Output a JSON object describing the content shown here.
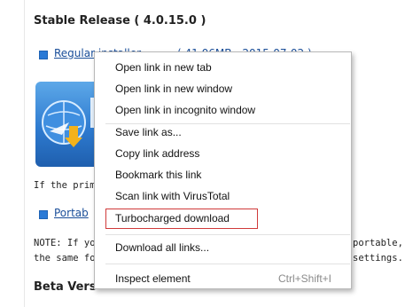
{
  "page": {
    "stable_heading": "Stable Release ( 4.0.15.0 )",
    "regular_link_label": "Regular installer",
    "regular_link_meta": "( 41.06MB - 2015-07-02 )",
    "primary_note_start": "If the prima",
    "portable_link_label": "Portab",
    "note_line1_start": "NOTE: If yo",
    "note_line1_end": "portable, c",
    "note_line2_start": "the same fo",
    "note_line2_end": "settings.",
    "beta_heading": "Beta Vers"
  },
  "context_menu": {
    "items": [
      {
        "label": "Open link in new tab"
      },
      {
        "label": "Open link in new window"
      },
      {
        "label": "Open link in incognito window"
      },
      {
        "label": "Save link as..."
      },
      {
        "label": "Copy link address"
      },
      {
        "label": "Bookmark this link"
      },
      {
        "label": "Scan link with VirusTotal"
      },
      {
        "label": "Turbocharged download"
      },
      {
        "label": "Download all links..."
      },
      {
        "label": "Inspect element",
        "shortcut": "Ctrl+Shift+I"
      }
    ],
    "highlight_color": "#d03a3a"
  }
}
